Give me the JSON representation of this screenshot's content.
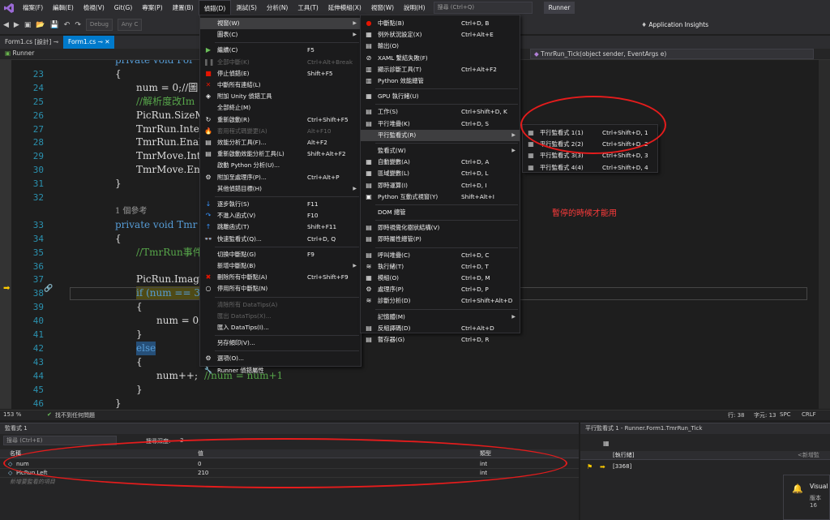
{
  "menubar": {
    "items": [
      "檔案(F)",
      "編輯(E)",
      "檢視(V)",
      "Git(G)",
      "專案(P)",
      "建置(B)",
      "偵錯(D)",
      "測試(S)",
      "分析(N)",
      "工具(T)",
      "延伸模組(X)",
      "視窗(W)",
      "說明(H)"
    ],
    "search_placeholder": "搜尋 (Ctrl+Q)",
    "project": "Runner"
  },
  "toolbar": {
    "config": "Debug",
    "cpu": "Any C",
    "insights": "Application Insights"
  },
  "tabs": {
    "items": [
      "Form1.cs [設計]",
      "Form1.cs"
    ]
  },
  "nav": {
    "left": "Runner",
    "right": "TmrRun_Tick(object sender, EventArgs e)"
  },
  "editor": {
    "lines": [
      {
        "n": "",
        "t": "private void For"
      },
      {
        "n": "23",
        "t": "{"
      },
      {
        "n": "24",
        "t": "num = 0;//圖"
      },
      {
        "n": "25",
        "t": "//解析度改Im"
      },
      {
        "n": "26",
        "t": "PicRun.SizeM"
      },
      {
        "n": "27",
        "t": "TmrRun.Inter"
      },
      {
        "n": "28",
        "t": "TmrRun.Enabl"
      },
      {
        "n": "29",
        "t": "TmrMove.Inte"
      },
      {
        "n": "30",
        "t": "TmrMove.Enab"
      },
      {
        "n": "31",
        "t": "}"
      },
      {
        "n": "32",
        "t": ""
      },
      {
        "n": "",
        "t": "1 個參考"
      },
      {
        "n": "33",
        "t": "private void Tmr"
      },
      {
        "n": "34",
        "t": "{"
      },
      {
        "n": "35",
        "t": "//TmrRun事件"
      },
      {
        "n": "36",
        "t": ""
      },
      {
        "n": "37",
        "t": "PicRun.Image"
      },
      {
        "n": "38",
        "t": "if (num == 3"
      },
      {
        "n": "39",
        "t": "{"
      },
      {
        "n": "40",
        "t": "num = 0;"
      },
      {
        "n": "41",
        "t": "}"
      },
      {
        "n": "42",
        "t": "else"
      },
      {
        "n": "43",
        "t": "{"
      },
      {
        "n": "44",
        "t": "num++;"
      },
      {
        "n": "44b",
        "t": "//num = num+1"
      },
      {
        "n": "45",
        "t": "}"
      },
      {
        "n": "46",
        "t": "}"
      }
    ]
  },
  "status": {
    "zoom": "153 %",
    "issues": "找不到任何問題",
    "line": "行: 38",
    "char": "字元: 13",
    "spc": "SPC",
    "crlf": "CRLF"
  },
  "watch": {
    "title": "監看式 1",
    "search_placeholder": "搜尋 (Ctrl+E)",
    "depth_label": "搜尋深度:",
    "depth": "3",
    "col_name": "名稱",
    "col_value": "值",
    "col_type": "類型",
    "rows": [
      {
        "name": "num",
        "value": "0",
        "type": "int"
      },
      {
        "name": "PicRun.Left",
        "value": "210",
        "type": "int"
      }
    ],
    "add_placeholder": "新增要監看的項目"
  },
  "parallel": {
    "title": "平行監看式 1 - Runner.Form1.TmrRun_Tick",
    "col_thread": "[執行緒]",
    "thread": "[3368]",
    "add_watch": "<新增監"
  },
  "notification": {
    "title": "Visual",
    "body": "版本 16"
  },
  "annotation": "暫停的時候才能用",
  "debug_menu": {
    "items": [
      {
        "label": "視窗(W)",
        "sc": "",
        "arrow": true,
        "hl": true,
        "icon": ""
      },
      {
        "label": "圖表(C)",
        "sc": "",
        "arrow": true,
        "icon": ""
      },
      {
        "label": "繼續(C)",
        "sc": "F5",
        "icon": "▶",
        "ic": "#6bbf59"
      },
      {
        "label": "全部中斷(K)",
        "sc": "Ctrl+Alt+Break",
        "dis": true,
        "icon": "❚❚"
      },
      {
        "label": "停止偵錯(E)",
        "sc": "Shift+F5",
        "icon": "■",
        "ic": "#e51400"
      },
      {
        "label": "中斷所有連結(L)",
        "sc": "",
        "icon": "✕",
        "ic": "#e51400"
      },
      {
        "label": "附加 Unity 偵錯工具",
        "sc": "",
        "icon": "◈"
      },
      {
        "label": "全部終止(M)",
        "sc": "",
        "icon": ""
      },
      {
        "label": "重新啟動(R)",
        "sc": "Ctrl+Shift+F5",
        "icon": "↻"
      },
      {
        "label": "套用程式碼變更(A)",
        "sc": "Alt+F10",
        "dis": true,
        "icon": "🔥"
      },
      {
        "label": "效能分析工具(F)...",
        "sc": "Alt+F2",
        "icon": "▤"
      },
      {
        "label": "重新啟動效能分析工具(L)",
        "sc": "Shift+Alt+F2",
        "icon": "▤"
      },
      {
        "label": "啟動 Python 分析(U)...",
        "sc": "",
        "icon": ""
      },
      {
        "label": "附加至處理序(P)...",
        "sc": "Ctrl+Alt+P",
        "icon": "⚙"
      },
      {
        "label": "其他偵錯目標(H)",
        "sc": "",
        "arrow": true,
        "icon": ""
      },
      {
        "label": "逐步執行(S)",
        "sc": "F11",
        "icon": "↓",
        "ic": "#3794ff"
      },
      {
        "label": "不進入函式(V)",
        "sc": "F10",
        "icon": "↷",
        "ic": "#3794ff"
      },
      {
        "label": "跳離函式(T)",
        "sc": "Shift+F11",
        "icon": "↑",
        "ic": "#3794ff"
      },
      {
        "label": "快速監看式(Q)...",
        "sc": "Ctrl+D, Q",
        "icon": "👓"
      },
      {
        "label": "切換中斷點(G)",
        "sc": "F9",
        "icon": ""
      },
      {
        "label": "新增中斷點(B)",
        "sc": "",
        "arrow": true,
        "icon": ""
      },
      {
        "label": "刪除所有中斷點(A)",
        "sc": "Ctrl+Shift+F9",
        "icon": "✖",
        "ic": "#e51400"
      },
      {
        "label": "停用所有中斷點(N)",
        "sc": "",
        "icon": "○"
      },
      {
        "label": "清除所有 DataTips(A)",
        "sc": "",
        "dis": true,
        "icon": ""
      },
      {
        "label": "匯出 DataTips(X)...",
        "sc": "",
        "dis": true,
        "icon": ""
      },
      {
        "label": "匯入 DataTips(I)...",
        "sc": "",
        "icon": ""
      },
      {
        "label": "另存傾印(V)...",
        "sc": "",
        "icon": ""
      },
      {
        "label": "選項(O)...",
        "sc": "",
        "icon": "⚙"
      },
      {
        "label": "Runner 偵錯屬性",
        "sc": "",
        "icon": "🔧"
      }
    ]
  },
  "windows_menu": {
    "items": [
      {
        "label": "中斷點(B)",
        "sc": "Ctrl+D, B",
        "icon": "●",
        "ic": "#e51400"
      },
      {
        "label": "例外狀況設定(X)",
        "sc": "Ctrl+Alt+E",
        "icon": "▦"
      },
      {
        "label": "輸出(O)",
        "sc": "",
        "icon": "▤"
      },
      {
        "label": "XAML 繫結失敗(F)",
        "sc": "",
        "icon": "⊘"
      },
      {
        "label": "顯示診斷工具(T)",
        "sc": "Ctrl+Alt+F2",
        "icon": "▥"
      },
      {
        "label": "Python 效能總管",
        "sc": "",
        "icon": "▥"
      },
      {
        "label": "GPU 執行緒(U)",
        "sc": "",
        "icon": "▦"
      },
      {
        "label": "工作(S)",
        "sc": "Ctrl+Shift+D, K",
        "icon": "▤"
      },
      {
        "label": "平行堆疊(K)",
        "sc": "Ctrl+D, S",
        "icon": "▤"
      },
      {
        "label": "平行監看式(R)",
        "sc": "",
        "arrow": true,
        "hl": true,
        "icon": ""
      },
      {
        "label": "監看式(W)",
        "sc": "",
        "arrow": true,
        "icon": ""
      },
      {
        "label": "自動變數(A)",
        "sc": "Ctrl+D, A",
        "icon": "▦"
      },
      {
        "label": "區域變數(L)",
        "sc": "Ctrl+D, L",
        "icon": "▦"
      },
      {
        "label": "即時運算(I)",
        "sc": "Ctrl+D, I",
        "icon": "▤"
      },
      {
        "label": "Python 互動式視窗(Y)",
        "sc": "Shift+Alt+I",
        "icon": "▣"
      },
      {
        "label": "DOM 總管",
        "sc": "",
        "icon": ""
      },
      {
        "label": "即時視覺化樹狀結構(V)",
        "sc": "",
        "icon": "▤"
      },
      {
        "label": "即時屬性總管(P)",
        "sc": "",
        "icon": "▤"
      },
      {
        "label": "呼叫堆疊(C)",
        "sc": "Ctrl+D, C",
        "icon": "▤"
      },
      {
        "label": "執行緒(T)",
        "sc": "Ctrl+D, T",
        "icon": "≋"
      },
      {
        "label": "模組(O)",
        "sc": "Ctrl+D, M",
        "icon": "▦"
      },
      {
        "label": "處理序(P)",
        "sc": "Ctrl+D, P",
        "icon": "⚙"
      },
      {
        "label": "診斷分析(D)",
        "sc": "Ctrl+Shift+Alt+D",
        "icon": "≋"
      },
      {
        "label": "記憶體(M)",
        "sc": "",
        "arrow": true,
        "icon": ""
      },
      {
        "label": "反組譯碼(D)",
        "sc": "Ctrl+Alt+D",
        "icon": "▤"
      },
      {
        "label": "暫存器(G)",
        "sc": "Ctrl+D, R",
        "icon": "▤"
      }
    ]
  },
  "parallel_menu": {
    "items": [
      {
        "label": "平行監看式 1(1)",
        "sc": "Ctrl+Shift+D, 1"
      },
      {
        "label": "平行監看式 2(2)",
        "sc": "Ctrl+Shift+D, 2"
      },
      {
        "label": "平行監看式 3(3)",
        "sc": "Ctrl+Shift+D, 3"
      },
      {
        "label": "平行監看式 4(4)",
        "sc": "Ctrl+Shift+D, 4"
      }
    ]
  }
}
